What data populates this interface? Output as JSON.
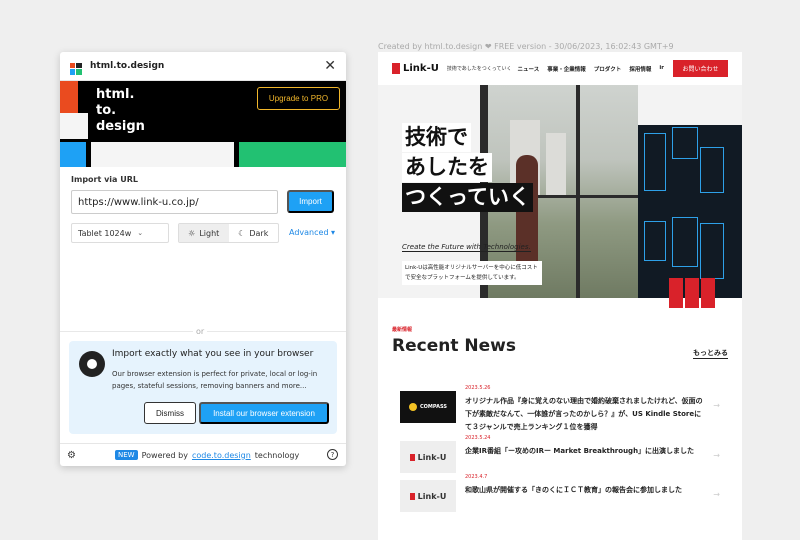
{
  "plugin": {
    "title": "html.to.design",
    "close_icon": "close-icon",
    "banner": {
      "text_lines": [
        "html.",
        "to.",
        "design"
      ],
      "upgrade_label": "Upgrade to PRO",
      "colors": {
        "red": "#ea4b1f",
        "blue": "#1ea1f5",
        "green": "#22c172",
        "yellow": "#f2b72b"
      }
    },
    "import_label": "Import via URL",
    "url_value": "https://www.link-u.co.jp/",
    "import_button": "Import",
    "device_select": "Tablet 1024w",
    "theme": {
      "light": "Light",
      "dark": "Dark",
      "selected": "Light"
    },
    "advanced_label": "Advanced ▾",
    "or_text": "or",
    "extension": {
      "title": "Import exactly what you see in your browser",
      "description": "Our browser extension is perfect for private, local or log-in pages, stateful sessions, removing banners and more...",
      "dismiss": "Dismiss",
      "install": "Install our browser extension"
    },
    "footer": {
      "new_badge": "NEW",
      "powered_by": "Powered by",
      "link": "code.to.design",
      "technology": "technology"
    }
  },
  "preview": {
    "created_by": "Created by html.to.design ❤ FREE version - 30/06/2023, 16:02:43 GMT+9",
    "logo": "Link-U",
    "tagline": "技術であしたをつくっていく",
    "nav": [
      "ニュース",
      "事業・企業情報",
      "プロダクト",
      "採用情報",
      "ir"
    ],
    "contact_button": "お問い合わせ",
    "hero": {
      "lines": [
        "技術で",
        "あしたを",
        "つくっていく"
      ],
      "subtitle": "Create the Future with Technologies.",
      "description": "Link-Uは高性能オリジナルサーバーを中心に低コストで安全なプラットフォームを提供しています。"
    },
    "news_eyebrow": "最新情報",
    "news_title": "Recent News",
    "more_label": "もっとみる",
    "news": [
      {
        "thumb": "COMPASS",
        "date": "2023.5.26",
        "text": "オリジナル作品『身に覚えのない理由で婚約破棄されましたけれど、仮面の下が素敵だなんて、一体誰が言ったのかしら？』が、US Kindle Storeにて３ジャンルで売上ランキング１位を獲得"
      },
      {
        "thumb": "Link-U",
        "date": "2023.5.24",
        "text": "企業IR番組「ー攻めのIRー Market Breakthrough」に出演しました"
      },
      {
        "thumb": "Link-U",
        "date": "2023.4.7",
        "text": "和歌山県が開催する「きのくにＩＣＴ教育」の報告会に参加しました"
      }
    ]
  }
}
